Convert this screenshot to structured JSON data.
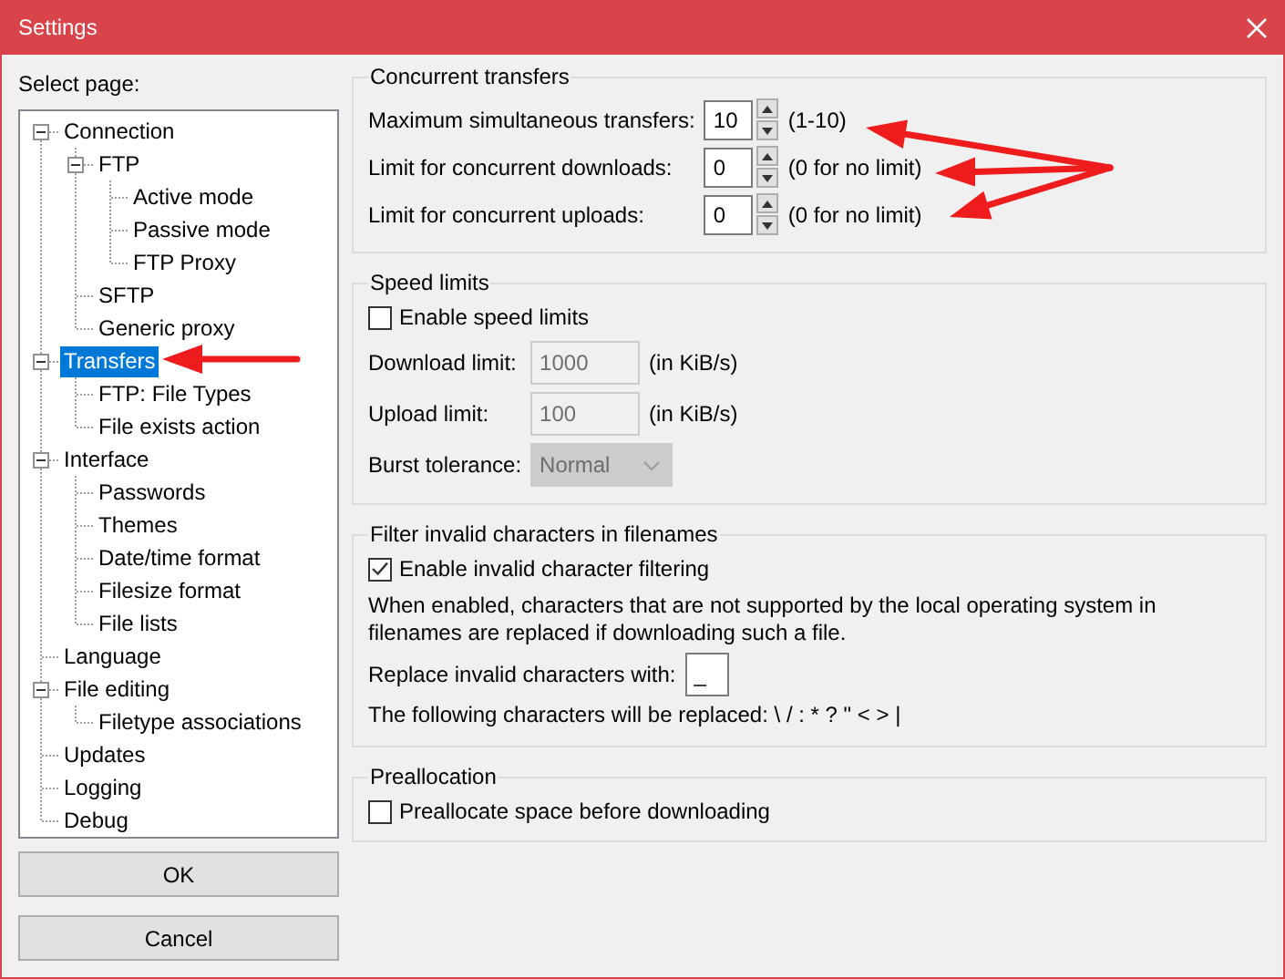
{
  "window": {
    "title": "Settings"
  },
  "sidebar": {
    "label": "Select page:",
    "tree": [
      {
        "label": "Connection",
        "selected": false,
        "expanded": true,
        "children": [
          {
            "label": "FTP",
            "selected": false,
            "expanded": true,
            "children": [
              {
                "label": "Active mode",
                "selected": false
              },
              {
                "label": "Passive mode",
                "selected": false
              },
              {
                "label": "FTP Proxy",
                "selected": false
              }
            ]
          },
          {
            "label": "SFTP",
            "selected": false
          },
          {
            "label": "Generic proxy",
            "selected": false
          }
        ]
      },
      {
        "label": "Transfers",
        "selected": true,
        "expanded": true,
        "children": [
          {
            "label": "FTP: File Types",
            "selected": false
          },
          {
            "label": "File exists action",
            "selected": false
          }
        ]
      },
      {
        "label": "Interface",
        "selected": false,
        "expanded": true,
        "children": [
          {
            "label": "Passwords",
            "selected": false
          },
          {
            "label": "Themes",
            "selected": false
          },
          {
            "label": "Date/time format",
            "selected": false
          },
          {
            "label": "Filesize format",
            "selected": false
          },
          {
            "label": "File lists",
            "selected": false
          }
        ]
      },
      {
        "label": "Language",
        "selected": false
      },
      {
        "label": "File editing",
        "selected": false,
        "expanded": true,
        "children": [
          {
            "label": "Filetype associations",
            "selected": false
          }
        ]
      },
      {
        "label": "Updates",
        "selected": false
      },
      {
        "label": "Logging",
        "selected": false
      },
      {
        "label": "Debug",
        "selected": false
      }
    ]
  },
  "buttons": [
    {
      "label": "OK"
    },
    {
      "label": "Cancel"
    }
  ],
  "groups": [
    {
      "title": "Concurrent transfers",
      "rows": [
        {
          "kind": "spin",
          "label": "Maximum simultaneous transfers:",
          "value": "10",
          "hint": "(1-10)"
        },
        {
          "kind": "spin",
          "label": "Limit for concurrent downloads:",
          "value": "0",
          "hint": "(0 for no limit)"
        },
        {
          "kind": "spin",
          "label": "Limit for concurrent uploads:",
          "value": "0",
          "hint": "(0 for no limit)"
        }
      ]
    },
    {
      "title": "Speed limits",
      "rows": [
        {
          "kind": "checkbox",
          "label": "Enable speed limits",
          "checked": false
        },
        {
          "kind": "field",
          "label": "Download limit:",
          "value": "1000",
          "hint": "(in KiB/s)",
          "disabled": true
        },
        {
          "kind": "field",
          "label": "Upload limit:",
          "value": "100",
          "hint": "(in KiB/s)",
          "disabled": true
        },
        {
          "kind": "select",
          "label": "Burst tolerance:",
          "value": "Normal",
          "disabled": true
        }
      ]
    },
    {
      "title": "Filter invalid characters in filenames",
      "rows": [
        {
          "kind": "checkbox",
          "label": "Enable invalid character filtering",
          "checked": true
        },
        {
          "kind": "text",
          "text": "When enabled, characters that are not supported by the local operating system in filenames are replaced if downloading such a file."
        },
        {
          "kind": "field",
          "label": "Replace invalid characters with:",
          "value": "_",
          "disabled": false
        },
        {
          "kind": "text",
          "text": "The following characters will be replaced: \\ / : * ? \" < > |"
        }
      ]
    },
    {
      "title": "Preallocation",
      "rows": [
        {
          "kind": "checkbox",
          "label": "Preallocate space before downloading",
          "checked": false
        }
      ]
    }
  ]
}
